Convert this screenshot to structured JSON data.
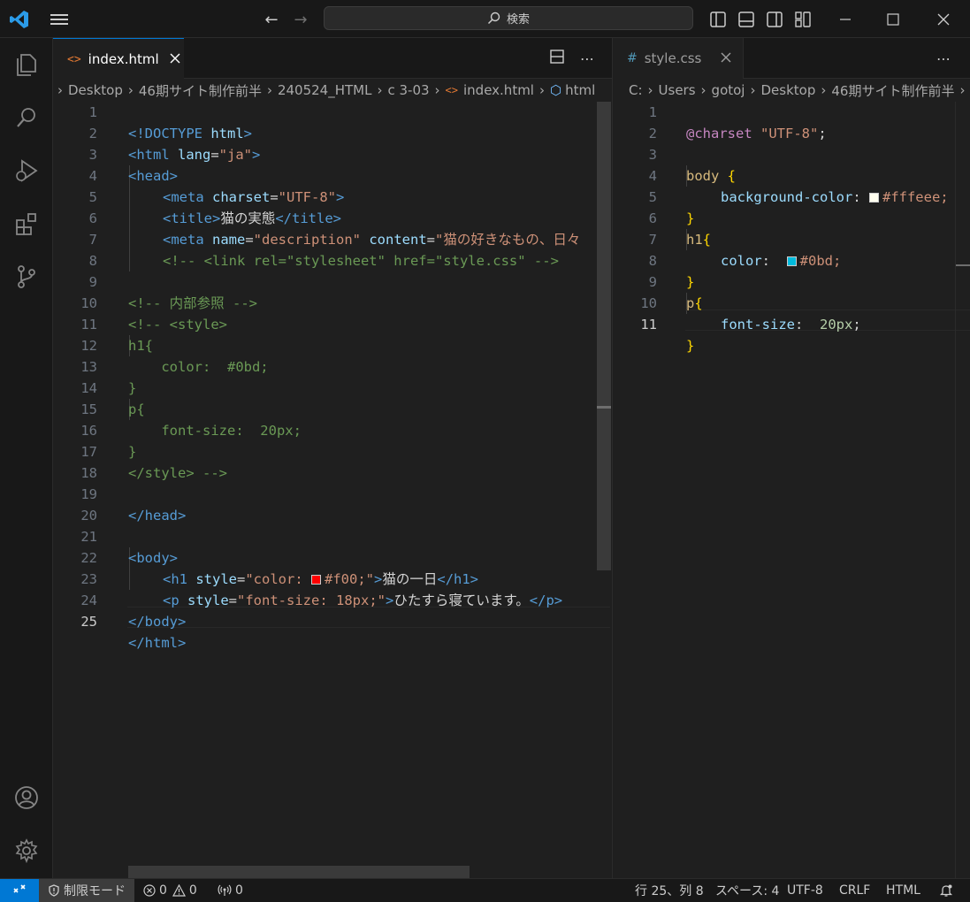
{
  "titlebar": {
    "search_placeholder": "検索",
    "accent_color": "#0078d4"
  },
  "activity_bar": {
    "items": [
      "explorer-icon",
      "search-icon",
      "run-debug-icon",
      "extensions-icon",
      "source-control-icon"
    ],
    "bottom_items": [
      "account-icon",
      "settings-gear-icon"
    ]
  },
  "left_editor": {
    "tab_label": "index.html",
    "breadcrumb": [
      "Desktop",
      "46期サイト制作前半",
      "240524_HTML",
      "c 3-03",
      "index.html",
      "html"
    ],
    "line_numbers": [
      "1",
      "2",
      "3",
      "4",
      "5",
      "6",
      "7",
      "8",
      "9",
      "10",
      "11",
      "12",
      "13",
      "14",
      "15",
      "16",
      "17",
      "18",
      "19",
      "20",
      "21",
      "22",
      "23",
      "24",
      "25"
    ],
    "current_line": "25"
  },
  "right_editor": {
    "tab_label": "style.css",
    "breadcrumb": [
      "C:",
      "Users",
      "gotoj",
      "Desktop",
      "46期サイト制作前半"
    ],
    "line_numbers": [
      "1",
      "2",
      "3",
      "4",
      "5",
      "6",
      "7",
      "8",
      "9",
      "10",
      "11"
    ],
    "current_line": "11"
  },
  "html_code": {
    "l1a": "<!DOCTYPE ",
    "l1b": "html",
    "l1c": ">",
    "l2a": "<html ",
    "l2b": "lang",
    "l2c": "=",
    "l2d": "\"ja\"",
    "l2e": ">",
    "l3": "<head>",
    "l4a": "<meta ",
    "l4b": "charset",
    "l4c": "=",
    "l4d": "\"UTF-8\"",
    "l4e": ">",
    "l5a": "<title>",
    "l5b": "猫の実態",
    "l5c": "</title>",
    "l6a": "<meta ",
    "l6b": "name",
    "l6c": "=",
    "l6d": "\"description\"",
    "l6e": " content",
    "l6f": "=",
    "l6g": "\"猫の好きなもの、日々",
    "l7": "<!-- <link rel=\"stylesheet\" href=\"style.css\" -->",
    "l9": "<!-- 内部参照 -->",
    "l10": "<!-- <style>",
    "l11": "h1{",
    "l12": "    color:  #0bd;",
    "l13": "}",
    "l14": "p{",
    "l15": "    font-size:  20px;",
    "l16": "}",
    "l17": "</style> -->",
    "l19": "</head>",
    "l21": "<body>",
    "l22a": "<h1 ",
    "l22b": "style",
    "l22c": "=",
    "l22d": "\"color: ",
    "l22e": "#f00;\"",
    "l22f": ">",
    "l22g": "猫の一日",
    "l22h": "</h1>",
    "l23a": "<p ",
    "l23b": "style",
    "l23c": "=",
    "l23d": "\"font-size: 18px;\"",
    "l23e": ">",
    "l23f": "ひたすら寝ています。",
    "l23g": "</p>",
    "l24": "</body>",
    "l25": "</html>",
    "swatch_red": "#ff0000"
  },
  "css_code": {
    "l1a": "@charset ",
    "l1b": "\"UTF-8\"",
    "l1c": ";",
    "l3a": "body ",
    "l3b": "{",
    "l4a": "background-color",
    "l4b": ": ",
    "l4c": "#fffeee;",
    "l5": "}",
    "l6a": "h1",
    "l6b": "{",
    "l7a": "color",
    "l7b": ":  ",
    "l7c": "#0bd;",
    "l8": "}",
    "l9a": "p",
    "l9b": "{",
    "l10a": "font-size",
    "l10b": ":  ",
    "l10c": "20px",
    "l10d": ";",
    "l11": "}",
    "swatch_cream": "#fffeee",
    "swatch_cyan": "#00bbdd"
  },
  "statusbar": {
    "restricted_mode": "制限モード",
    "errors": "0",
    "warnings": "0",
    "ports": "0",
    "position": "行 25、列 8",
    "spaces": "スペース: 4",
    "encoding": "UTF-8",
    "eol": "CRLF",
    "language": "HTML"
  }
}
